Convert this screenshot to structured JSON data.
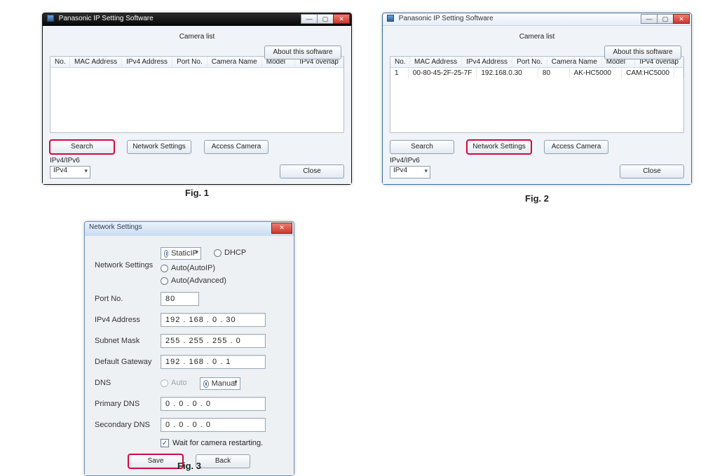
{
  "captions": {
    "fig1": "Fig. 1",
    "fig2": "Fig. 2",
    "fig3": "Fig. 3"
  },
  "app_title": "Panasonic IP Setting Software",
  "about_button": "About this software",
  "list_heading": "Camera list",
  "columns": {
    "no": "No.",
    "mac": "MAC Address",
    "ip": "IPv4 Address",
    "port": "Port No.",
    "camname": "Camera Name",
    "model": "Model",
    "overlap": "IPv4 overlap"
  },
  "buttons": {
    "search": "Search",
    "network": "Network Settings",
    "access": "Access Camera",
    "close": "Close",
    "save": "Save",
    "back": "Back"
  },
  "proto_label": "IPv4/IPv6",
  "proto_value": "IPv4",
  "fig2_row": {
    "no": "1",
    "mac": "00-80-45-2F-25-7F",
    "ip": "192.168.0.30",
    "port": "80",
    "camname": "AK-HC5000",
    "model": "CAM:HC5000",
    "overlap": ""
  },
  "dlg": {
    "title": "Network Settings",
    "section": "Network Settings",
    "modes": {
      "static": "StaticIP",
      "dhcp": "DHCP",
      "autoip": "Auto(AutoIP)",
      "autoadv": "Auto(Advanced)"
    },
    "port_label": "Port No.",
    "port_value": "80",
    "ipv4_label": "IPv4 Address",
    "ipv4_value": "192 . 168 .   0 .  30",
    "mask_label": "Subnet Mask",
    "mask_value": "255 . 255 . 255 .   0",
    "gw_label": "Default Gateway",
    "gw_value": "192 . 168 .   0 .   1",
    "dns_label": "DNS",
    "dns_auto": "Auto",
    "dns_manual": "Manual",
    "pdns_label": "Primary DNS",
    "pdns_value": "0 .   0 .   0 .   0",
    "sdns_label": "Secondary DNS",
    "sdns_value": "0 .   0 .   0 .   0",
    "wait_label": "Wait for camera restarting."
  }
}
